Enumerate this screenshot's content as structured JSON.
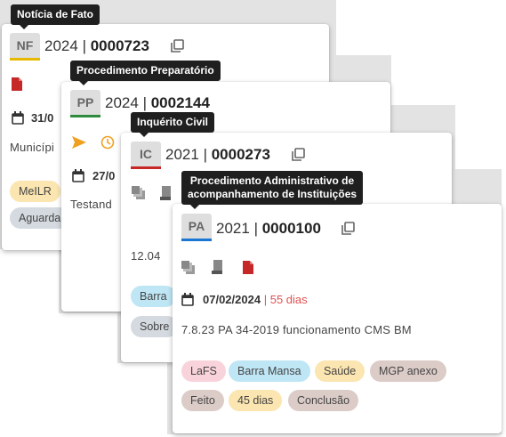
{
  "cards": [
    {
      "tooltip": "Notícia de Fato",
      "abbr": "NF",
      "year": "2024",
      "number": "0000723",
      "date": "31/0",
      "description": "Municípi",
      "tags": [
        "MeILR",
        "Aguarda"
      ],
      "color": "#e6b800"
    },
    {
      "tooltip": "Procedimento Preparatório",
      "abbr": "PP",
      "year": "2024",
      "number": "0002144",
      "date": "27/0",
      "description": "Testand",
      "color": "#2e8b3d"
    },
    {
      "tooltip": "Inquérito Civil",
      "abbr": "IC",
      "year": "2021",
      "number": "0000273",
      "description": "12.04",
      "tags": [
        "Barra",
        "Sobre"
      ],
      "color": "#c62828"
    },
    {
      "tooltip_line1": "Procedimento Administrativo de",
      "tooltip_line2": "acompanhamento de Instituições",
      "abbr": "PA",
      "year": "2021",
      "number": "0000100",
      "date": "07/02/2024",
      "days": "55 dias",
      "description": "7.8.23 PA 34-2019 funcionamento CMS BM",
      "tags": [
        "LaFS",
        "Barra Mansa",
        "Saúde",
        "MGP anexo",
        "Feito",
        "45 dias",
        "Conclusão"
      ],
      "color": "#1976d2"
    }
  ],
  "separator": "|",
  "date_separator": "|",
  "icons": [
    "copy-icon",
    "pdf-file-icon",
    "calendar-icon",
    "send-icon",
    "clock-icon",
    "stack-icon",
    "print-icon"
  ]
}
